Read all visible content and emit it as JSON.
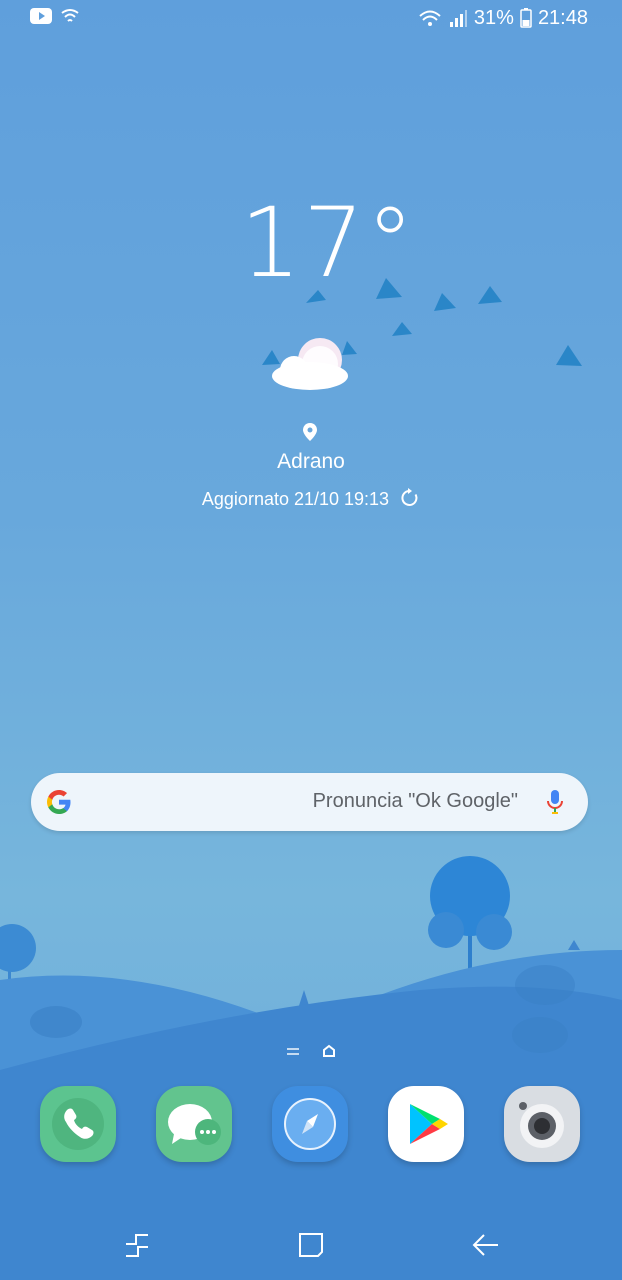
{
  "status_bar": {
    "battery_percent": "31%",
    "time": "21:48",
    "icons": [
      "youtube-icon",
      "wifi-icon",
      "wifi-icon",
      "signal-icon",
      "battery-icon"
    ]
  },
  "weather": {
    "temperature": "17°",
    "condition_icon": "partly-cloudy-icon",
    "location": "Adrano",
    "updated": "Aggiornato 21/10 19:13"
  },
  "search": {
    "placeholder": "Pronuncia \"Ok Google\"",
    "icons": [
      "google-icon",
      "mic-icon"
    ]
  },
  "dock": {
    "apps": [
      "phone-icon",
      "messages-icon",
      "internet-icon",
      "play-store-icon",
      "camera-icon"
    ]
  },
  "navigation": {
    "buttons": [
      "recents-button",
      "home-button",
      "back-button"
    ]
  },
  "colors": {
    "sky_top": "#5f9fdc",
    "sky_bottom": "#77b6dc",
    "hill": "#3f86cf",
    "search_bg": "#eef5fb"
  }
}
